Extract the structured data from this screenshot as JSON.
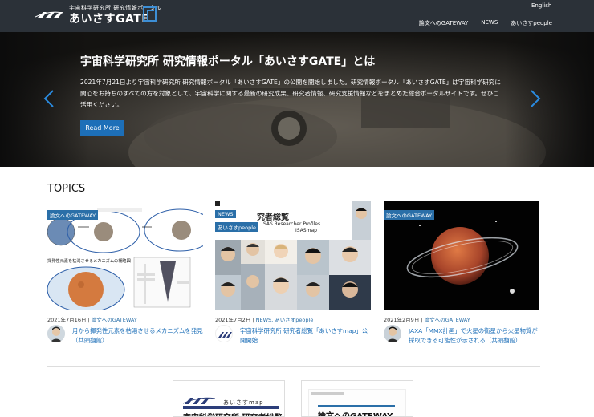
{
  "header": {
    "logo_sub": "宇宙科学研究所 研究情報ポータル",
    "logo_main": "あいさすGATE",
    "lang": "English",
    "nav": [
      "論文へのGATEWAY",
      "NEWS",
      "あいさすpeople"
    ]
  },
  "hero": {
    "title": "宇宙科学研究所 研究情報ポータル「あいさすGATE」とは",
    "text": "2021年7月21日より宇宙科学研究所 研究情報ポータル「あいさすGATE」の公開を開始しました。研究情報ポータル「あいさすGATE」は宇宙科学研究に関心をお持ちのすべての方を対象として、宇宙科学に関する最新の研究成果、研究者情報、研究支援情報などをまとめた総合ポータルサイトです。ぜひご活用ください。",
    "button": "Read More"
  },
  "topics": {
    "title": "TOPICS",
    "cards": [
      {
        "tags": [
          "論文へのGATEWAY"
        ],
        "date": "2021年7月16日",
        "category": "論文へのGATEWAY",
        "headline": "月から揮発性元素を枯渇させるメカニズムを発見（共頭翻館）",
        "img_text": "揮発性元素を枯渇させるメカニズムの概略図"
      },
      {
        "tags": [
          "NEWS",
          "あいさすpeople"
        ],
        "date": "2021年7月2日",
        "category": "NEWS, あいさすpeople",
        "headline": "宇宙科学研究所 研究者総覧「あいさすmap」公開開始",
        "img_title": "究者総覧",
        "img_sub": "SAS Researcher Profiles",
        "img_sub2": "ISASmap"
      },
      {
        "tags": [
          "論文へのGATEWAY"
        ],
        "date": "2021年2月9日",
        "category": "論文へのGATEWAY",
        "headline": "JAXA「MMX計画」で火星の衛星から火星物質が採取できる可能性が示される（共頭翻館）"
      }
    ]
  },
  "banners": {
    "b1_small": "あいさすmap",
    "b1_big": "宇宙科学研究所 研究者総覧",
    "b2_big": "論文へのGATEWAY"
  },
  "colors": {
    "header_bg": "#2b3138",
    "accent": "#1d6fb8",
    "tag_bg": "#2a6fa8"
  }
}
